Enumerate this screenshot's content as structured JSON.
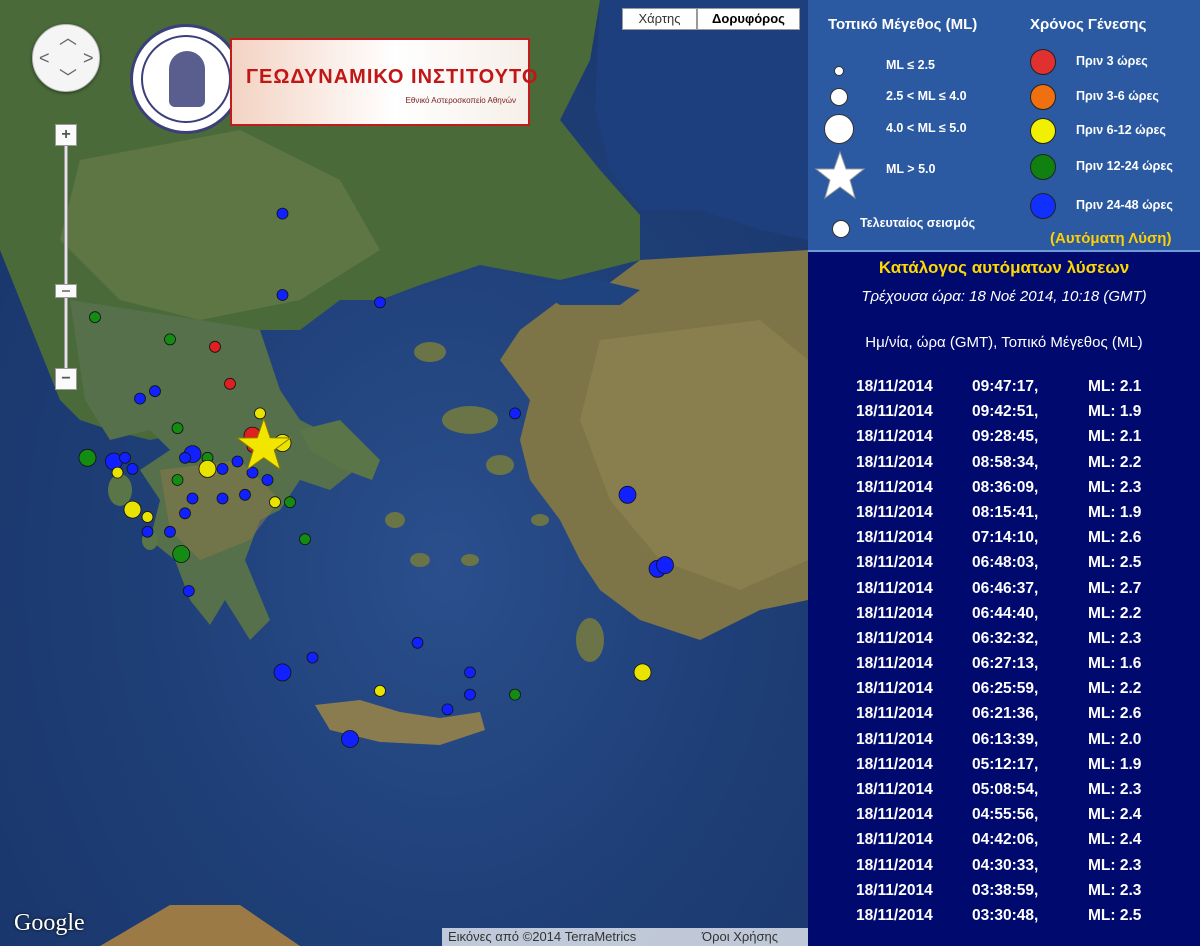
{
  "map": {
    "map_type_buttons": {
      "map": "Χάρτης",
      "satellite": "Δορυφόρος",
      "selected": "satellite"
    },
    "zoom": {
      "in": "+",
      "out": "−"
    },
    "logo": {
      "name": "ΓΕΩΔΥΝΑΜΙΚΟ ΙΝΣΤΙΤΟΥΤΟ",
      "subtitle": "Εθνικό Αστεροσκοπείο Αθηνών"
    },
    "google": "Google",
    "attribution": "Εικόνες από ©2014 TerraMetrics",
    "terms": "Όροι Χρήσης",
    "epicenter_star_color": "#f2e600",
    "events": [
      {
        "lon": 23.0,
        "lat": 41.8,
        "size": "small",
        "color": "#1020ff"
      },
      {
        "lon": 23.0,
        "lat": 40.7,
        "size": "small",
        "color": "#1020ff"
      },
      {
        "lon": 24.3,
        "lat": 40.6,
        "size": "small",
        "color": "#1020ff"
      },
      {
        "lon": 20.5,
        "lat": 40.4,
        "size": "small",
        "color": "#148c14"
      },
      {
        "lon": 21.5,
        "lat": 40.1,
        "size": "small",
        "color": "#148c14"
      },
      {
        "lon": 22.1,
        "lat": 40.0,
        "size": "small",
        "color": "#e02020"
      },
      {
        "lon": 22.3,
        "lat": 39.5,
        "size": "small",
        "color": "#e02020"
      },
      {
        "lon": 21.1,
        "lat": 39.3,
        "size": "small",
        "color": "#1020ff"
      },
      {
        "lon": 21.3,
        "lat": 39.4,
        "size": "small",
        "color": "#1020ff"
      },
      {
        "lon": 22.7,
        "lat": 39.1,
        "size": "small",
        "color": "#e8e400"
      },
      {
        "lon": 26.1,
        "lat": 39.1,
        "size": "small",
        "color": "#1020ff"
      },
      {
        "lon": 21.6,
        "lat": 38.9,
        "size": "small",
        "color": "#148c14"
      },
      {
        "lon": 22.6,
        "lat": 38.8,
        "size": "medium",
        "color": "#e02020"
      },
      {
        "lon": 23.0,
        "lat": 38.7,
        "size": "medium",
        "color": "#e8e400"
      },
      {
        "lon": 22.6,
        "lat": 38.65,
        "size": "small",
        "color": "#e02020"
      },
      {
        "lon": 22.7,
        "lat": 38.6,
        "size": "small",
        "color": "#1020ff"
      },
      {
        "lon": 20.4,
        "lat": 38.5,
        "size": "medium",
        "color": "#148c14"
      },
      {
        "lon": 20.75,
        "lat": 38.45,
        "size": "medium",
        "color": "#1020ff"
      },
      {
        "lon": 20.9,
        "lat": 38.5,
        "size": "small",
        "color": "#1020ff"
      },
      {
        "lon": 21.0,
        "lat": 38.35,
        "size": "small",
        "color": "#1020ff"
      },
      {
        "lon": 20.8,
        "lat": 38.3,
        "size": "small",
        "color": "#e8e400"
      },
      {
        "lon": 21.8,
        "lat": 38.55,
        "size": "medium",
        "color": "#1020ff"
      },
      {
        "lon": 22.0,
        "lat": 38.5,
        "size": "small",
        "color": "#148c14"
      },
      {
        "lon": 21.7,
        "lat": 38.5,
        "size": "small",
        "color": "#1020ff"
      },
      {
        "lon": 22.0,
        "lat": 38.35,
        "size": "medium",
        "color": "#e8e400"
      },
      {
        "lon": 22.2,
        "lat": 38.35,
        "size": "small",
        "color": "#1020ff"
      },
      {
        "lon": 22.4,
        "lat": 38.45,
        "size": "small",
        "color": "#1020ff"
      },
      {
        "lon": 22.6,
        "lat": 38.3,
        "size": "small",
        "color": "#1020ff"
      },
      {
        "lon": 21.6,
        "lat": 38.2,
        "size": "small",
        "color": "#148c14"
      },
      {
        "lon": 22.8,
        "lat": 38.2,
        "size": "small",
        "color": "#1020ff"
      },
      {
        "lon": 21.8,
        "lat": 37.95,
        "size": "small",
        "color": "#1020ff"
      },
      {
        "lon": 22.5,
        "lat": 38.0,
        "size": "small",
        "color": "#1020ff"
      },
      {
        "lon": 22.9,
        "lat": 37.9,
        "size": "small",
        "color": "#e8e400"
      },
      {
        "lon": 23.1,
        "lat": 37.9,
        "size": "small",
        "color": "#148c14"
      },
      {
        "lon": 22.2,
        "lat": 37.95,
        "size": "small",
        "color": "#1020ff"
      },
      {
        "lon": 21.0,
        "lat": 37.8,
        "size": "medium",
        "color": "#e8e400"
      },
      {
        "lon": 21.2,
        "lat": 37.7,
        "size": "small",
        "color": "#e8e400"
      },
      {
        "lon": 21.7,
        "lat": 37.75,
        "size": "small",
        "color": "#1020ff"
      },
      {
        "lon": 21.2,
        "lat": 37.5,
        "size": "small",
        "color": "#1020ff"
      },
      {
        "lon": 21.5,
        "lat": 37.5,
        "size": "small",
        "color": "#1020ff"
      },
      {
        "lon": 21.65,
        "lat": 37.2,
        "size": "medium",
        "color": "#148c14"
      },
      {
        "lon": 23.3,
        "lat": 37.4,
        "size": "small",
        "color": "#148c14"
      },
      {
        "lon": 21.75,
        "lat": 36.7,
        "size": "small",
        "color": "#1020ff"
      },
      {
        "lon": 27.6,
        "lat": 38.0,
        "size": "medium",
        "color": "#1020ff"
      },
      {
        "lon": 28.0,
        "lat": 37.0,
        "size": "medium",
        "color": "#1020ff"
      },
      {
        "lon": 28.1,
        "lat": 37.05,
        "size": "medium",
        "color": "#1020ff"
      },
      {
        "lon": 23.4,
        "lat": 35.8,
        "size": "small",
        "color": "#1020ff"
      },
      {
        "lon": 24.8,
        "lat": 36.0,
        "size": "small",
        "color": "#1020ff"
      },
      {
        "lon": 23.0,
        "lat": 35.6,
        "size": "medium",
        "color": "#1020ff"
      },
      {
        "lon": 24.3,
        "lat": 35.35,
        "size": "small",
        "color": "#e8e400"
      },
      {
        "lon": 25.5,
        "lat": 35.6,
        "size": "small",
        "color": "#1020ff"
      },
      {
        "lon": 25.5,
        "lat": 35.3,
        "size": "small",
        "color": "#1020ff"
      },
      {
        "lon": 26.1,
        "lat": 35.3,
        "size": "small",
        "color": "#148c14"
      },
      {
        "lon": 25.2,
        "lat": 35.1,
        "size": "small",
        "color": "#1020ff"
      },
      {
        "lon": 27.8,
        "lat": 35.6,
        "size": "medium",
        "color": "#e8e400"
      },
      {
        "lon": 23.9,
        "lat": 34.7,
        "size": "medium",
        "color": "#1020ff"
      }
    ],
    "star_event": {
      "lon": 22.75,
      "lat": 38.65
    }
  },
  "legend": {
    "magnitude_title": "Τοπικό Μέγεθος (ML)",
    "origin_title": "Χρόνος Γένεσης",
    "magnitudes": [
      {
        "label": "ML ≤ 2.5"
      },
      {
        "label": "2.5 < ML ≤ 4.0"
      },
      {
        "label": "4.0 < ML ≤ 5.0"
      },
      {
        "label": "ML > 5.0"
      }
    ],
    "last_event_label": "Τελευταίος σεισμός",
    "times": [
      {
        "label": "Πριν 3 ώρες",
        "color": "#e03030"
      },
      {
        "label": "Πριν 3-6 ώρες",
        "color": "#f07010"
      },
      {
        "label": "Πριν 6-12 ώρες",
        "color": "#f0f000"
      },
      {
        "label": "Πριν 12-24 ώρες",
        "color": "#108010"
      },
      {
        "label": "Πριν 24-48 ώρες",
        "color": "#1030ff"
      }
    ],
    "auto_solution": "(Αυτόματη Λύση)"
  },
  "catalog": {
    "title": "Κατάλογος αυτόματων λύσεων",
    "current_time": "Τρέχουσα ώρα: 18 Νοέ 2014, 10:18 (GMT)",
    "columns": "Ημ/νία, ώρα (GMT), Τοπικό Μέγεθος (ML)",
    "entries": [
      {
        "date": "18/11/2014",
        "time": "09:47:17,",
        "ml": "ML: 2.1"
      },
      {
        "date": "18/11/2014",
        "time": "09:42:51,",
        "ml": "ML: 1.9"
      },
      {
        "date": "18/11/2014",
        "time": "09:28:45,",
        "ml": "ML: 2.1"
      },
      {
        "date": "18/11/2014",
        "time": "08:58:34,",
        "ml": "ML: 2.2"
      },
      {
        "date": "18/11/2014",
        "time": "08:36:09,",
        "ml": "ML: 2.3"
      },
      {
        "date": "18/11/2014",
        "time": "08:15:41,",
        "ml": "ML: 1.9"
      },
      {
        "date": "18/11/2014",
        "time": "07:14:10,",
        "ml": "ML: 2.6"
      },
      {
        "date": "18/11/2014",
        "time": "06:48:03,",
        "ml": "ML: 2.5"
      },
      {
        "date": "18/11/2014",
        "time": "06:46:37,",
        "ml": "ML: 2.7"
      },
      {
        "date": "18/11/2014",
        "time": "06:44:40,",
        "ml": "ML: 2.2"
      },
      {
        "date": "18/11/2014",
        "time": "06:32:32,",
        "ml": "ML: 2.3"
      },
      {
        "date": "18/11/2014",
        "time": "06:27:13,",
        "ml": "ML: 1.6"
      },
      {
        "date": "18/11/2014",
        "time": "06:25:59,",
        "ml": "ML: 2.2"
      },
      {
        "date": "18/11/2014",
        "time": "06:21:36,",
        "ml": "ML: 2.6"
      },
      {
        "date": "18/11/2014",
        "time": "06:13:39,",
        "ml": "ML: 2.0"
      },
      {
        "date": "18/11/2014",
        "time": "05:12:17,",
        "ml": "ML: 1.9"
      },
      {
        "date": "18/11/2014",
        "time": "05:08:54,",
        "ml": "ML: 2.3"
      },
      {
        "date": "18/11/2014",
        "time": "04:55:56,",
        "ml": "ML: 2.4"
      },
      {
        "date": "18/11/2014",
        "time": "04:42:06,",
        "ml": "ML: 2.4"
      },
      {
        "date": "18/11/2014",
        "time": "04:30:33,",
        "ml": "ML: 2.3"
      },
      {
        "date": "18/11/2014",
        "time": "03:38:59,",
        "ml": "ML: 2.3"
      },
      {
        "date": "18/11/2014",
        "time": "03:30:48,",
        "ml": "ML: 2.5"
      }
    ]
  }
}
